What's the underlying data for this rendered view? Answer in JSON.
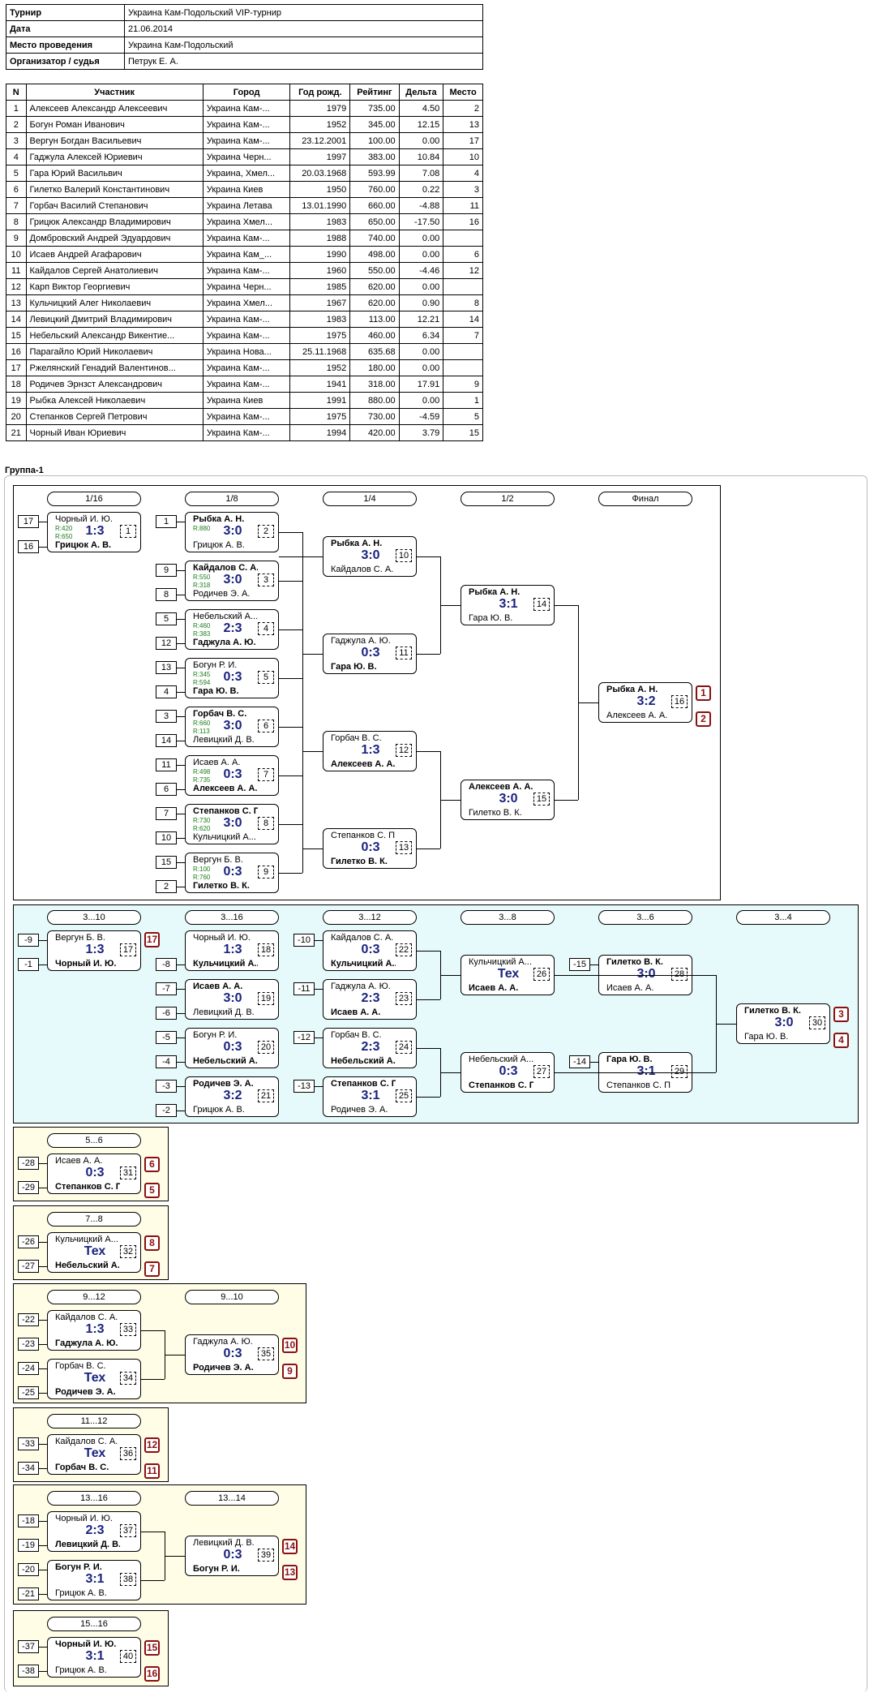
{
  "info": [
    {
      "k": "Турнир",
      "v": "Украина Кам-Подольский VIP-турнир"
    },
    {
      "k": "Дата",
      "v": "21.06.2014"
    },
    {
      "k": "Место проведения",
      "v": "Украина Кам-Подольский"
    },
    {
      "k": "Организатор / судья",
      "v": "Петрук Е. А."
    }
  ],
  "headers": [
    "N",
    "Участник",
    "Город",
    "Год рожд.",
    "Рейтинг",
    "Дельта",
    "Место"
  ],
  "rows": [
    [
      "1",
      "Алексеев Александр Алексеевич",
      "Украина Кам-...",
      "1979",
      "735.00",
      "4.50",
      "2"
    ],
    [
      "2",
      "Богун Роман Иванович",
      "Украина Кам-...",
      "1952",
      "345.00",
      "12.15",
      "13"
    ],
    [
      "3",
      "Вергун Богдан Васильевич",
      "Украина Кам-...",
      "23.12.2001",
      "100.00",
      "0.00",
      "17"
    ],
    [
      "4",
      "Гаджула Алексей Юриевич",
      "Украина Черн...",
      "1997",
      "383.00",
      "10.84",
      "10"
    ],
    [
      "5",
      "Гара Юрий Васильвич",
      "Украина, Хмел...",
      "20.03.1968",
      "593.99",
      "7.08",
      "4"
    ],
    [
      "6",
      "Гилетко Валерий Константинович",
      "Украина Киев",
      "1950",
      "760.00",
      "0.22",
      "3"
    ],
    [
      "7",
      "Горбач Василий Степанович",
      "Украина Летава",
      "13.01.1990",
      "660.00",
      "-4.88",
      "11"
    ],
    [
      "8",
      "Грицюк Александр Владимирович",
      "Украина Хмел...",
      "1983",
      "650.00",
      "-17.50",
      "16"
    ],
    [
      "9",
      "Домбровский Андрей Эдуардович",
      "Украина Кам-...",
      "1988",
      "740.00",
      "0.00",
      ""
    ],
    [
      "10",
      "Исаев Андрей Агафарович",
      "Украина Кам_...",
      "1990",
      "498.00",
      "0.00",
      "6"
    ],
    [
      "11",
      "Кайдалов Сергей Анатолиевич",
      "Украина Кам-...",
      "1960",
      "550.00",
      "-4.46",
      "12"
    ],
    [
      "12",
      "Карп Виктор Георгиевич",
      "Украина Черн...",
      "1985",
      "620.00",
      "0.00",
      ""
    ],
    [
      "13",
      "Кульчицкий Алег Николаевич",
      "Украина Хмел...",
      "1967",
      "620.00",
      "0.90",
      "8"
    ],
    [
      "14",
      "Левицкий Дмитрий Владимирович",
      "Украина Кам-...",
      "1983",
      "113.00",
      "12.21",
      "14"
    ],
    [
      "15",
      "Небельский Александр Викентие...",
      "Украина Кам-...",
      "1975",
      "460.00",
      "6.34",
      "7"
    ],
    [
      "16",
      "Парагайло Юрий Николаевич",
      "Украина Нова...",
      "25.11.1968",
      "635.68",
      "0.00",
      ""
    ],
    [
      "17",
      "Ржелянский Генадий Валентинов...",
      "Украина Кам-...",
      "1952",
      "180.00",
      "0.00",
      ""
    ],
    [
      "18",
      "Родичев Эрнзст Александрович",
      "Украина Кам-...",
      "1941",
      "318.00",
      "17.91",
      "9"
    ],
    [
      "19",
      "Рыбка Алексей Николаевич",
      "Украина Киев",
      "1991",
      "880.00",
      "0.00",
      "1"
    ],
    [
      "20",
      "Степанков Сергей Петрович",
      "Украина Кам-...",
      "1975",
      "730.00",
      "-4.59",
      "5"
    ],
    [
      "21",
      "Чорный Иван Юриевич",
      "Украина Кам-...",
      "1994",
      "420.00",
      "3.79",
      "15"
    ]
  ],
  "group_title": "Группа-1",
  "colors": {
    "panel_main": "#ffffff",
    "panel_loser": "#e6fafb",
    "panel_place": "#fffde6",
    "score": "#1a237e",
    "rating": "#1b7d1b",
    "place_badge": "#8b1010"
  },
  "round_headers": [
    "1/16",
    "1/8",
    "1/4",
    "1/2",
    "Финал",
    "3...10",
    "3...16",
    "3...12",
    "3...8",
    "3...6",
    "3...4",
    "5...6",
    "7...8",
    "9...12",
    "9...10",
    "11...12",
    "13...16",
    "13...14",
    "15...16"
  ],
  "matches": [
    {
      "p1": "Чорный И. Ю.",
      "p2": "Грицюк А. В.",
      "score": "1:3",
      "num": "1",
      "w": 2,
      "ra": "R:420",
      "rb": "R:650"
    },
    {
      "p1": "Рыбка А. Н.",
      "p2": "Грицюк А. В.",
      "score": "3:0",
      "num": "2",
      "w": 1,
      "ra": "R:880",
      "rb": ""
    },
    {
      "p1": "Кайдалов С. А.",
      "p2": "Родичев Э. А.",
      "score": "3:0",
      "num": "3",
      "w": 1,
      "ra": "R:550",
      "rb": "R:318"
    },
    {
      "p1": "Небельский А...",
      "p2": "Гаджула А. Ю.",
      "score": "2:3",
      "num": "4",
      "w": 2,
      "ra": "R:460",
      "rb": "R:383"
    },
    {
      "p1": "Богун Р. И.",
      "p2": "Гара Ю. В.",
      "score": "0:3",
      "num": "5",
      "w": 2,
      "ra": "R:345",
      "rb": "R:594"
    },
    {
      "p1": "Горбач В. С.",
      "p2": "Левицкий Д. В.",
      "score": "3:0",
      "num": "6",
      "w": 1,
      "ra": "R:660",
      "rb": "R:113"
    },
    {
      "p1": "Исаев А. А.",
      "p2": "Алексеев А. А.",
      "score": "0:3",
      "num": "7",
      "w": 2,
      "ra": "R:498",
      "rb": "R:735"
    },
    {
      "p1": "Степанков С. П.",
      "p2": "Кульчицкий А...",
      "score": "3:0",
      "num": "8",
      "w": 1,
      "ra": "R:730",
      "rb": "R:620"
    },
    {
      "p1": "Вергун Б. В.",
      "p2": "Гилетко В. К.",
      "score": "0:3",
      "num": "9",
      "w": 2,
      "ra": "R:100",
      "rb": "R:760"
    },
    {
      "p1": "Рыбка А. Н.",
      "p2": "Кайдалов С. А.",
      "score": "3:0",
      "num": "10",
      "w": 1,
      "ra": "",
      "rb": ""
    },
    {
      "p1": "Гаджула А. Ю.",
      "p2": "Гара Ю. В.",
      "score": "0:3",
      "num": "11",
      "w": 2,
      "ra": "",
      "rb": ""
    },
    {
      "p1": "Горбач В. С.",
      "p2": "Алексеев А. А.",
      "score": "1:3",
      "num": "12",
      "w": 2,
      "ra": "",
      "rb": ""
    },
    {
      "p1": "Степанков С. П.",
      "p2": "Гилетко В. К.",
      "score": "0:3",
      "num": "13",
      "w": 2,
      "ra": "",
      "rb": ""
    },
    {
      "p1": "Рыбка А. Н.",
      "p2": "Гара Ю. В.",
      "score": "3:1",
      "num": "14",
      "w": 1,
      "ra": "",
      "rb": ""
    },
    {
      "p1": "Алексеев А. А.",
      "p2": "Гилетко В. К.",
      "score": "3:0",
      "num": "15",
      "w": 1,
      "ra": "",
      "rb": ""
    },
    {
      "p1": "Рыбка А. Н.",
      "p2": "Алексеев А. А.",
      "score": "3:2",
      "num": "16",
      "w": 1,
      "ra": "",
      "rb": ""
    },
    {
      "p1": "Вергун Б. В.",
      "p2": "Чорный И. Ю.",
      "score": "1:3",
      "num": "17",
      "w": 2,
      "ra": "",
      "rb": ""
    },
    {
      "p1": "Чорный И. Ю.",
      "p2": "Кульчицкий А...",
      "score": "1:3",
      "num": "18",
      "w": 2,
      "ra": "",
      "rb": ""
    },
    {
      "p1": "Исаев А. А.",
      "p2": "Левицкий Д. В.",
      "score": "3:0",
      "num": "19",
      "w": 1,
      "ra": "",
      "rb": ""
    },
    {
      "p1": "Богун Р. И.",
      "p2": "Небельский А...",
      "score": "0:3",
      "num": "20",
      "w": 2,
      "ra": "",
      "rb": ""
    },
    {
      "p1": "Родичев Э. А.",
      "p2": "Грицюк А. В.",
      "score": "3:2",
      "num": "21",
      "w": 1,
      "ra": "",
      "rb": ""
    },
    {
      "p1": "Кайдалов С. А.",
      "p2": "Кульчицкий А...",
      "score": "0:3",
      "num": "22",
      "w": 2,
      "ra": "",
      "rb": ""
    },
    {
      "p1": "Гаджула А. Ю.",
      "p2": "Исаев А. А.",
      "score": "2:3",
      "num": "23",
      "w": 2,
      "ra": "",
      "rb": ""
    },
    {
      "p1": "Горбач В. С.",
      "p2": "Небельский А...",
      "score": "2:3",
      "num": "24",
      "w": 2,
      "ra": "",
      "rb": ""
    },
    {
      "p1": "Степанков С. П.",
      "p2": "Родичев Э. А.",
      "score": "3:1",
      "num": "25",
      "w": 1,
      "ra": "",
      "rb": ""
    },
    {
      "p1": "Кульчицкий А...",
      "p2": "Исаев А. А.",
      "score": "Тех",
      "num": "26",
      "w": 2,
      "ra": "",
      "rb": ""
    },
    {
      "p1": "Небельский А...",
      "p2": "Степанков С. П.",
      "score": "0:3",
      "num": "27",
      "w": 2,
      "ra": "",
      "rb": ""
    },
    {
      "p1": "Гилетко В. К.",
      "p2": "Исаев А. А.",
      "score": "3:0",
      "num": "28",
      "w": 1,
      "ra": "",
      "rb": ""
    },
    {
      "p1": "Гара Ю. В.",
      "p2": "Степанков С. П.",
      "score": "3:1",
      "num": "29",
      "w": 1,
      "ra": "",
      "rb": ""
    },
    {
      "p1": "Гилетко В. К.",
      "p2": "Гара Ю. В.",
      "score": "3:0",
      "num": "30",
      "w": 1,
      "ra": "",
      "rb": ""
    },
    {
      "p1": "Исаев А. А.",
      "p2": "Степанков С. П.",
      "score": "0:3",
      "num": "31",
      "w": 2,
      "ra": "",
      "rb": ""
    },
    {
      "p1": "Кульчицкий А...",
      "p2": "Небельский А...",
      "score": "Тех",
      "num": "32",
      "w": 2,
      "ra": "",
      "rb": ""
    },
    {
      "p1": "Кайдалов С. А.",
      "p2": "Гаджула А. Ю.",
      "score": "1:3",
      "num": "33",
      "w": 2,
      "ra": "",
      "rb": ""
    },
    {
      "p1": "Горбач В. С.",
      "p2": "Родичев Э. А.",
      "score": "Тех",
      "num": "34",
      "w": 2,
      "ra": "",
      "rb": ""
    },
    {
      "p1": "Гаджула А. Ю.",
      "p2": "Родичев Э. А.",
      "score": "0:3",
      "num": "35",
      "w": 2,
      "ra": "",
      "rb": ""
    },
    {
      "p1": "Кайдалов С. А.",
      "p2": "Горбач В. С.",
      "score": "Тех",
      "num": "36",
      "w": 2,
      "ra": "",
      "rb": ""
    },
    {
      "p1": "Чорный И. Ю.",
      "p2": "Левицкий Д. В.",
      "score": "2:3",
      "num": "37",
      "w": 2,
      "ra": "",
      "rb": ""
    },
    {
      "p1": "Богун Р. И.",
      "p2": "Грицюк А. В.",
      "score": "3:1",
      "num": "38",
      "w": 1,
      "ra": "",
      "rb": ""
    },
    {
      "p1": "Левицкий Д. В.",
      "p2": "Богун Р. И.",
      "score": "0:3",
      "num": "39",
      "w": 2,
      "ra": "",
      "rb": ""
    },
    {
      "p1": "Чорный И. Ю.",
      "p2": "Грицюк А. В.",
      "score": "3:1",
      "num": "40",
      "w": 1,
      "ra": "",
      "rb": ""
    }
  ],
  "seeds": [
    "17",
    "16",
    "1",
    "9",
    "8",
    "5",
    "12",
    "13",
    "4",
    "3",
    "14",
    "11",
    "6",
    "7",
    "10",
    "15",
    "2",
    "-9",
    "-1",
    "-8",
    "-7",
    "-6",
    "-5",
    "-4",
    "-3",
    "-2",
    "-10",
    "-11",
    "-12",
    "-13",
    "-15",
    "-14",
    "-28",
    "-29",
    "-26",
    "-27",
    "-22",
    "-23",
    "-24",
    "-25",
    "-33",
    "-34",
    "-18",
    "-19",
    "-20",
    "-21",
    "-37",
    "-38"
  ],
  "places": [
    "1",
    "2",
    "17",
    "3",
    "4",
    "6",
    "5",
    "8",
    "7",
    "10",
    "9",
    "12",
    "11",
    "14",
    "13",
    "15",
    "16"
  ]
}
